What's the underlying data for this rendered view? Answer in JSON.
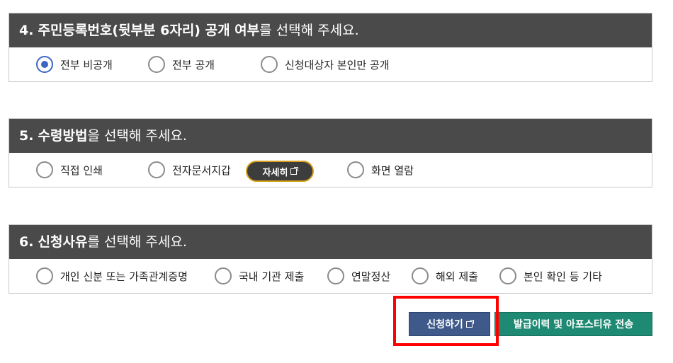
{
  "sections": [
    {
      "number": "4.",
      "title_bold": "주민등록번호(뒷부분 6자리) 공개 여부",
      "title_suffix": "를 선택해 주세요.",
      "options": [
        {
          "label": "전부 비공개",
          "checked": true
        },
        {
          "label": "전부 공개",
          "checked": false
        },
        {
          "label": "신청대상자 본인만 공개",
          "checked": false
        }
      ]
    },
    {
      "number": "5.",
      "title_bold": "수령방법",
      "title_suffix": "을 선택해 주세요.",
      "options": [
        {
          "label": "직접 인쇄",
          "checked": false
        },
        {
          "label": "전자문서지갑",
          "checked": false
        },
        {
          "label": "화면 열람",
          "checked": false
        }
      ],
      "detail_button": "자세히"
    },
    {
      "number": "6.",
      "title_bold": "신청사유",
      "title_suffix": "를 선택해 주세요.",
      "options": [
        {
          "label": "개인 신분 또는 가족관계증명",
          "checked": false
        },
        {
          "label": "국내 기관 제출",
          "checked": false
        },
        {
          "label": "연말정산",
          "checked": false
        },
        {
          "label": "해외 제출",
          "checked": false
        },
        {
          "label": "본인 확인 등 기타",
          "checked": false
        }
      ]
    }
  ],
  "actions": {
    "apply_label": "신청하기",
    "history_label": "발급이력 및 아포스티유 전송"
  },
  "colors": {
    "header_bg": "#4a4a4a",
    "radio_checked": "#3a66c4",
    "apply_bg": "#3f5a8a",
    "history_bg": "#1f8a73",
    "highlight": "#ff0000",
    "detail_border": "#d6a21e"
  }
}
